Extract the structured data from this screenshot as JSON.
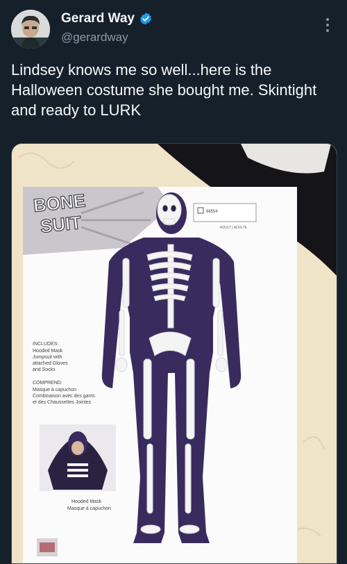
{
  "author": {
    "display_name": "Gerard Way",
    "handle": "@gerardway",
    "verified": true,
    "verified_icon": "verified-badge-icon"
  },
  "tweet": {
    "text": "Lindsey knows me so well...here is the Halloween costume she bought me. Skintight and ready to LURK"
  },
  "media": {
    "package": {
      "logo_line1": "BONE",
      "logo_line2": "SUIT",
      "size_code": "68554",
      "size_label": "ADULT | ADULTE",
      "includes_title": "INCLUDES:",
      "includes_items": [
        "Hooded Mask",
        "Jumpsuit with",
        "attached Gloves",
        "and Socks"
      ],
      "comprend_title": "COMPREND:",
      "comprend_items": [
        "Masque à capuchon",
        "Combinaison avec des gants",
        "et des Chaussettes Jointes"
      ],
      "mask_caption_en": "Hooded Mask",
      "mask_caption_fr": "Masque à capuchon"
    }
  },
  "colors": {
    "background": "#15202b",
    "text_primary": "#f7f9f9",
    "text_secondary": "#8b98a5",
    "verified_blue": "#1d9bf0"
  }
}
